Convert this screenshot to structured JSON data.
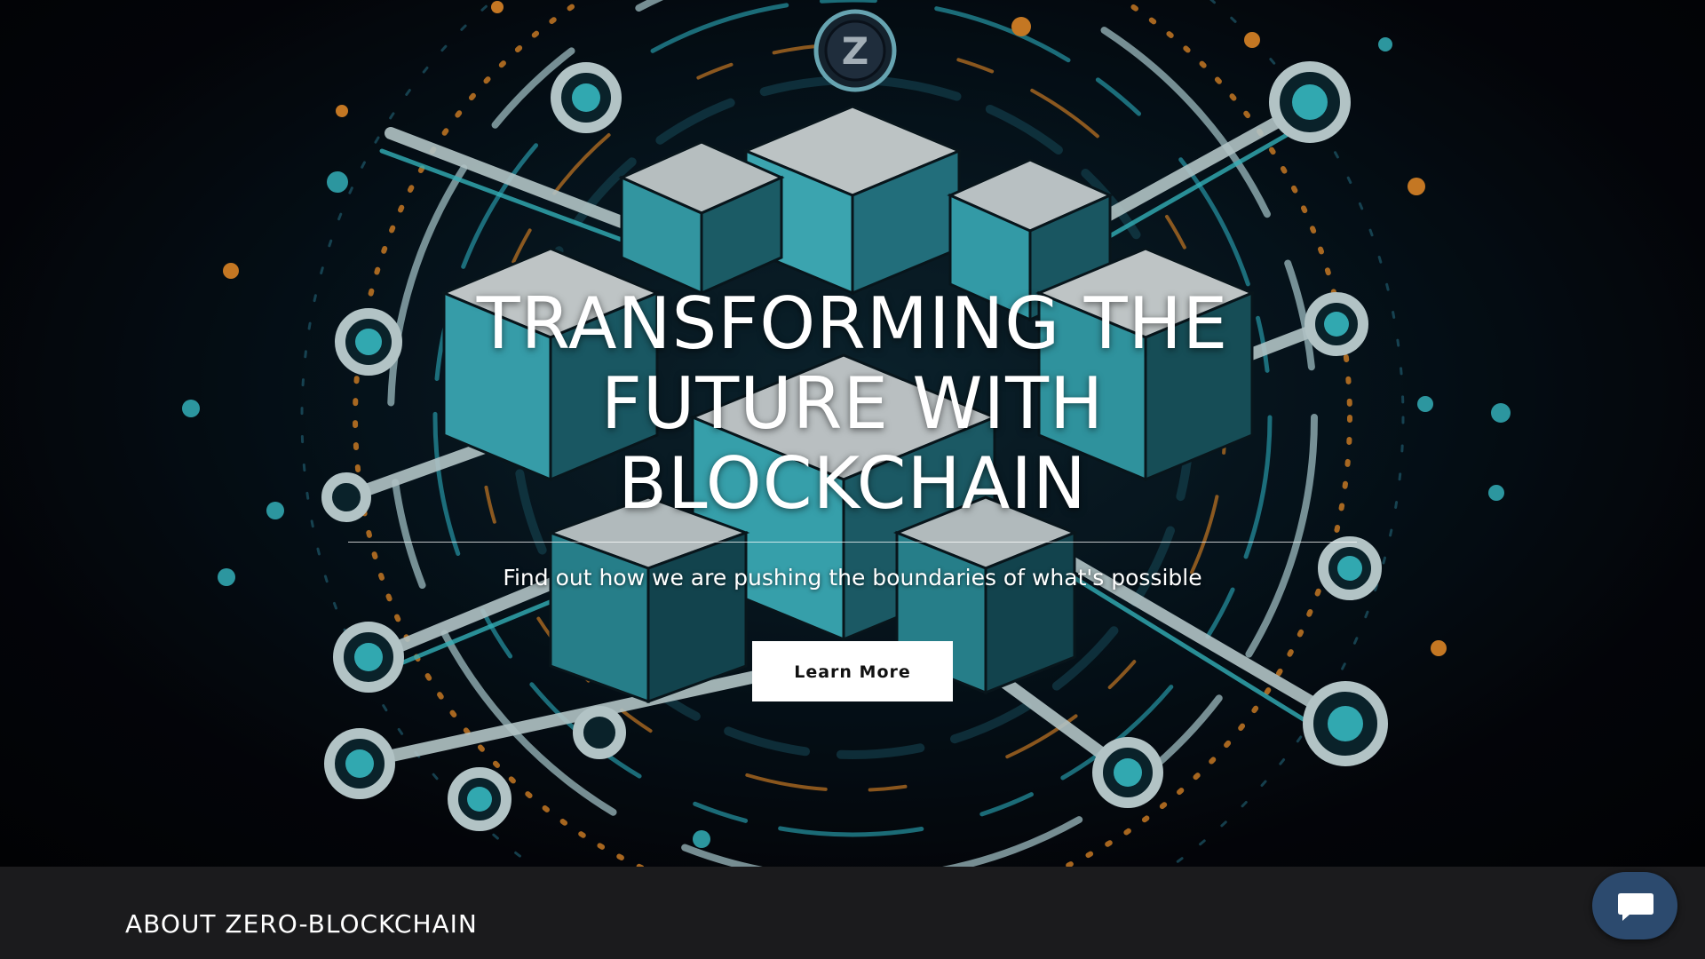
{
  "hero": {
    "title": "TRANSFORMING THE FUTURE WITH BLOCKCHAIN",
    "subtitle": "Find out how we are pushing the boundaries of what's possible",
    "cta_label": "Learn More",
    "logo_letter": "Z",
    "image_icon": "blockchain-circuit-illustration"
  },
  "about": {
    "title": "ABOUT ZERO-BLOCKCHAIN"
  },
  "chat": {
    "icon": "chat-bubble-icon"
  },
  "colors": {
    "hero_bg": "#04060b",
    "accent_cyan": "#3fd6e0",
    "accent_orange": "#f0922b",
    "about_bg": "#1b1b1d",
    "chat_bg": "#2c4a6e",
    "button_bg": "#ffffff"
  }
}
